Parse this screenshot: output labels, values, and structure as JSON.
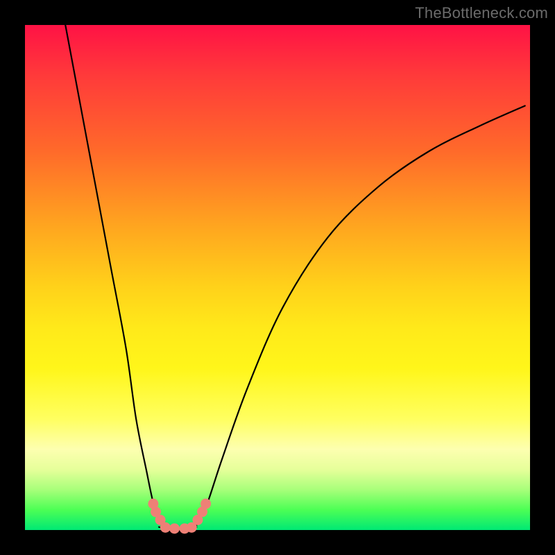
{
  "watermark": "TheBottleneck.com",
  "chart_data": {
    "type": "line",
    "title": "",
    "xlabel": "",
    "ylabel": "",
    "xlim": [
      0,
      100
    ],
    "ylim": [
      0,
      100
    ],
    "grid": false,
    "legend": false,
    "series": [
      {
        "name": "curve-left",
        "x": [
          8,
          11,
          14,
          17,
          20,
          22,
          24,
          25.5,
          27
        ],
        "values": [
          100,
          84,
          68,
          52,
          36,
          22,
          12,
          5,
          1
        ]
      },
      {
        "name": "curve-right",
        "x": [
          34,
          36,
          39,
          44,
          51,
          60,
          70,
          80,
          90,
          99
        ],
        "values": [
          1,
          5,
          14,
          28,
          44,
          58,
          68,
          75,
          80,
          84
        ]
      },
      {
        "name": "trough",
        "x": [
          26.5,
          28,
          30,
          32,
          34
        ],
        "values": [
          0.6,
          0.3,
          0.3,
          0.3,
          0.6
        ]
      }
    ],
    "markers": [
      {
        "name": "left-bead-1",
        "x": 25.4,
        "y": 5.2
      },
      {
        "name": "left-bead-2",
        "x": 25.9,
        "y": 3.6
      },
      {
        "name": "left-bead-3",
        "x": 26.8,
        "y": 2.0
      },
      {
        "name": "right-bead-1",
        "x": 34.2,
        "y": 2.0
      },
      {
        "name": "right-bead-2",
        "x": 35.1,
        "y": 3.6
      },
      {
        "name": "right-bead-3",
        "x": 35.8,
        "y": 5.2
      },
      {
        "name": "trough-bead-1",
        "x": 27.8,
        "y": 0.5
      },
      {
        "name": "trough-bead-2",
        "x": 29.6,
        "y": 0.3
      },
      {
        "name": "trough-bead-3",
        "x": 31.6,
        "y": 0.3
      },
      {
        "name": "trough-bead-4",
        "x": 33.0,
        "y": 0.5
      }
    ],
    "marker_color": "#ee8076",
    "curve_color": "#000000"
  }
}
